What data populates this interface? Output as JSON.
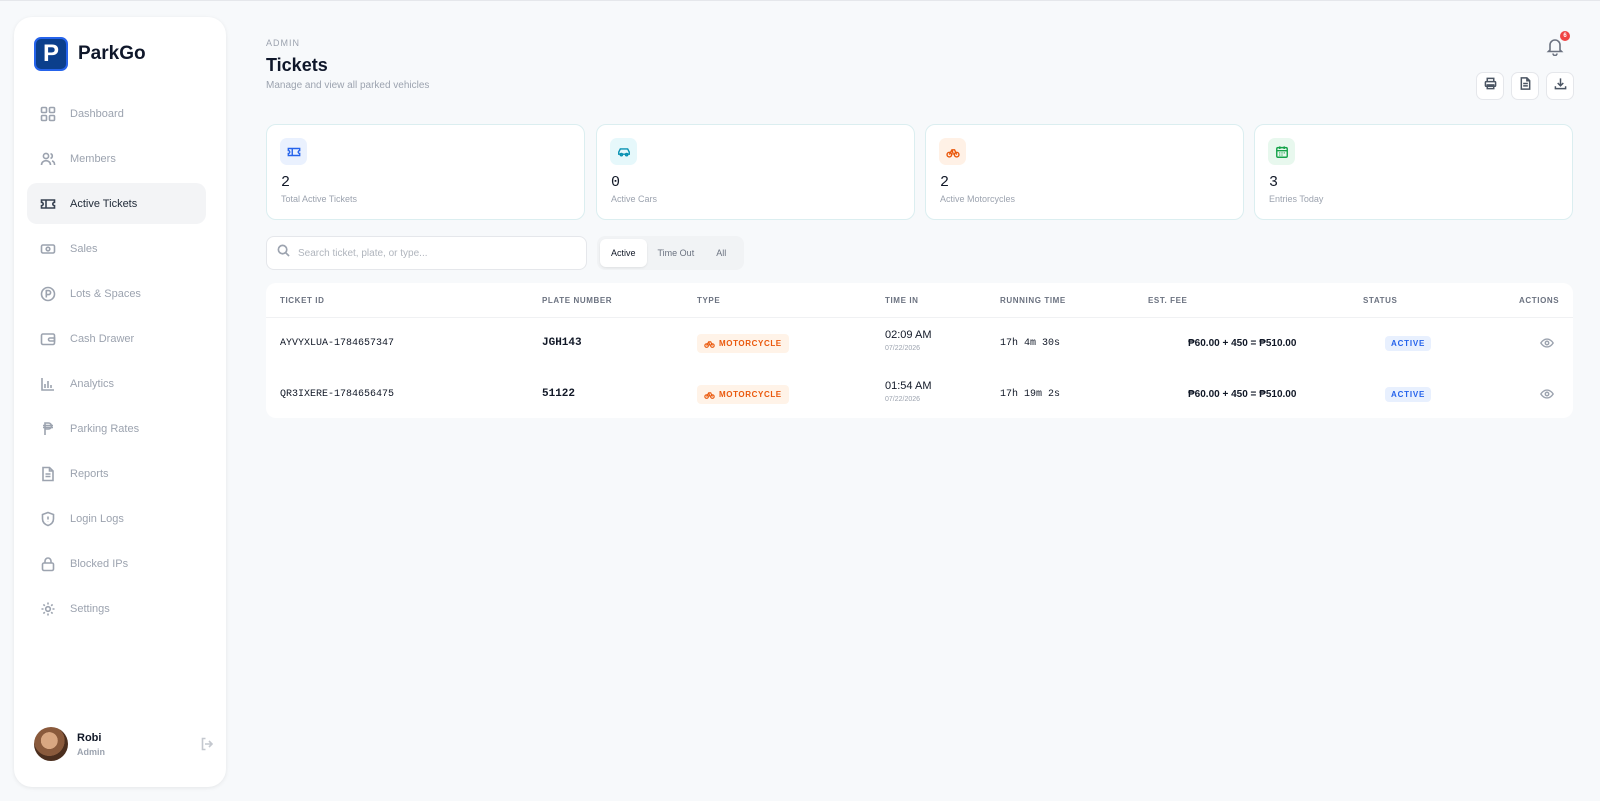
{
  "app": {
    "logo_letter": "P",
    "name": "ParkGo"
  },
  "sidebar": {
    "items": [
      {
        "label": "Dashboard",
        "icon": "grid-icon"
      },
      {
        "label": "Members",
        "icon": "users-icon"
      },
      {
        "label": "Active Tickets",
        "icon": "ticket-icon",
        "active": true
      },
      {
        "label": "Sales",
        "icon": "cash-icon"
      },
      {
        "label": "Lots & Spaces",
        "icon": "parking-icon"
      },
      {
        "label": "Cash Drawer",
        "icon": "wallet-icon"
      },
      {
        "label": "Analytics",
        "icon": "bar-chart-icon"
      },
      {
        "label": "Parking Rates",
        "icon": "peso-icon"
      },
      {
        "label": "Reports",
        "icon": "document-icon"
      },
      {
        "label": "Login Logs",
        "icon": "shield-icon"
      },
      {
        "label": "Blocked IPs",
        "icon": "lock-icon"
      },
      {
        "label": "Settings",
        "icon": "gear-icon"
      }
    ],
    "user": {
      "name": "Robi",
      "role": "Admin"
    }
  },
  "header": {
    "eyebrow": "ADMIN",
    "title": "Tickets",
    "subtitle": "Manage and view all parked vehicles",
    "notification_count": "6"
  },
  "stats": [
    {
      "value": "2",
      "label": "Total Active Tickets",
      "icon": "ticket-icon",
      "color": "#2563eb",
      "bg": "#eaf1fe"
    },
    {
      "value": "0",
      "label": "Active Cars",
      "icon": "car-icon",
      "color": "#0891b2",
      "bg": "#e6f8fb"
    },
    {
      "value": "2",
      "label": "Active Motorcycles",
      "icon": "bike-icon",
      "color": "#ea580c",
      "bg": "#fff1e6"
    },
    {
      "value": "3",
      "label": "Entries Today",
      "icon": "calendar-icon",
      "color": "#16a34a",
      "bg": "#e8f8ee"
    }
  ],
  "search": {
    "placeholder": "Search ticket, plate, or type..."
  },
  "filters": [
    {
      "label": "Active",
      "active": true
    },
    {
      "label": "Time Out"
    },
    {
      "label": "All"
    }
  ],
  "table": {
    "headers": {
      "ticket_id": "TICKET ID",
      "plate": "PLATE NUMBER",
      "type": "TYPE",
      "time_in": "TIME IN",
      "running": "RUNNING TIME",
      "fee": "EST. FEE",
      "status": "STATUS",
      "actions": "ACTIONS"
    },
    "rows": [
      {
        "ticket_id": "AYVYXLUA-1784657347",
        "plate": "JGH143",
        "type": "MOTORCYCLE",
        "time_in": "02:09 AM",
        "date_in": "07/22/2026",
        "running": "17h 4m 30s",
        "fee": "₱60.00 + 450 = ₱510.00",
        "status": "ACTIVE"
      },
      {
        "ticket_id": "QR3IXERE-1784656475",
        "plate": "51122",
        "type": "MOTORCYCLE",
        "time_in": "01:54 AM",
        "date_in": "07/22/2026",
        "running": "17h 19m 2s",
        "fee": "₱60.00 + 450 = ₱510.00",
        "status": "ACTIVE"
      }
    ]
  }
}
